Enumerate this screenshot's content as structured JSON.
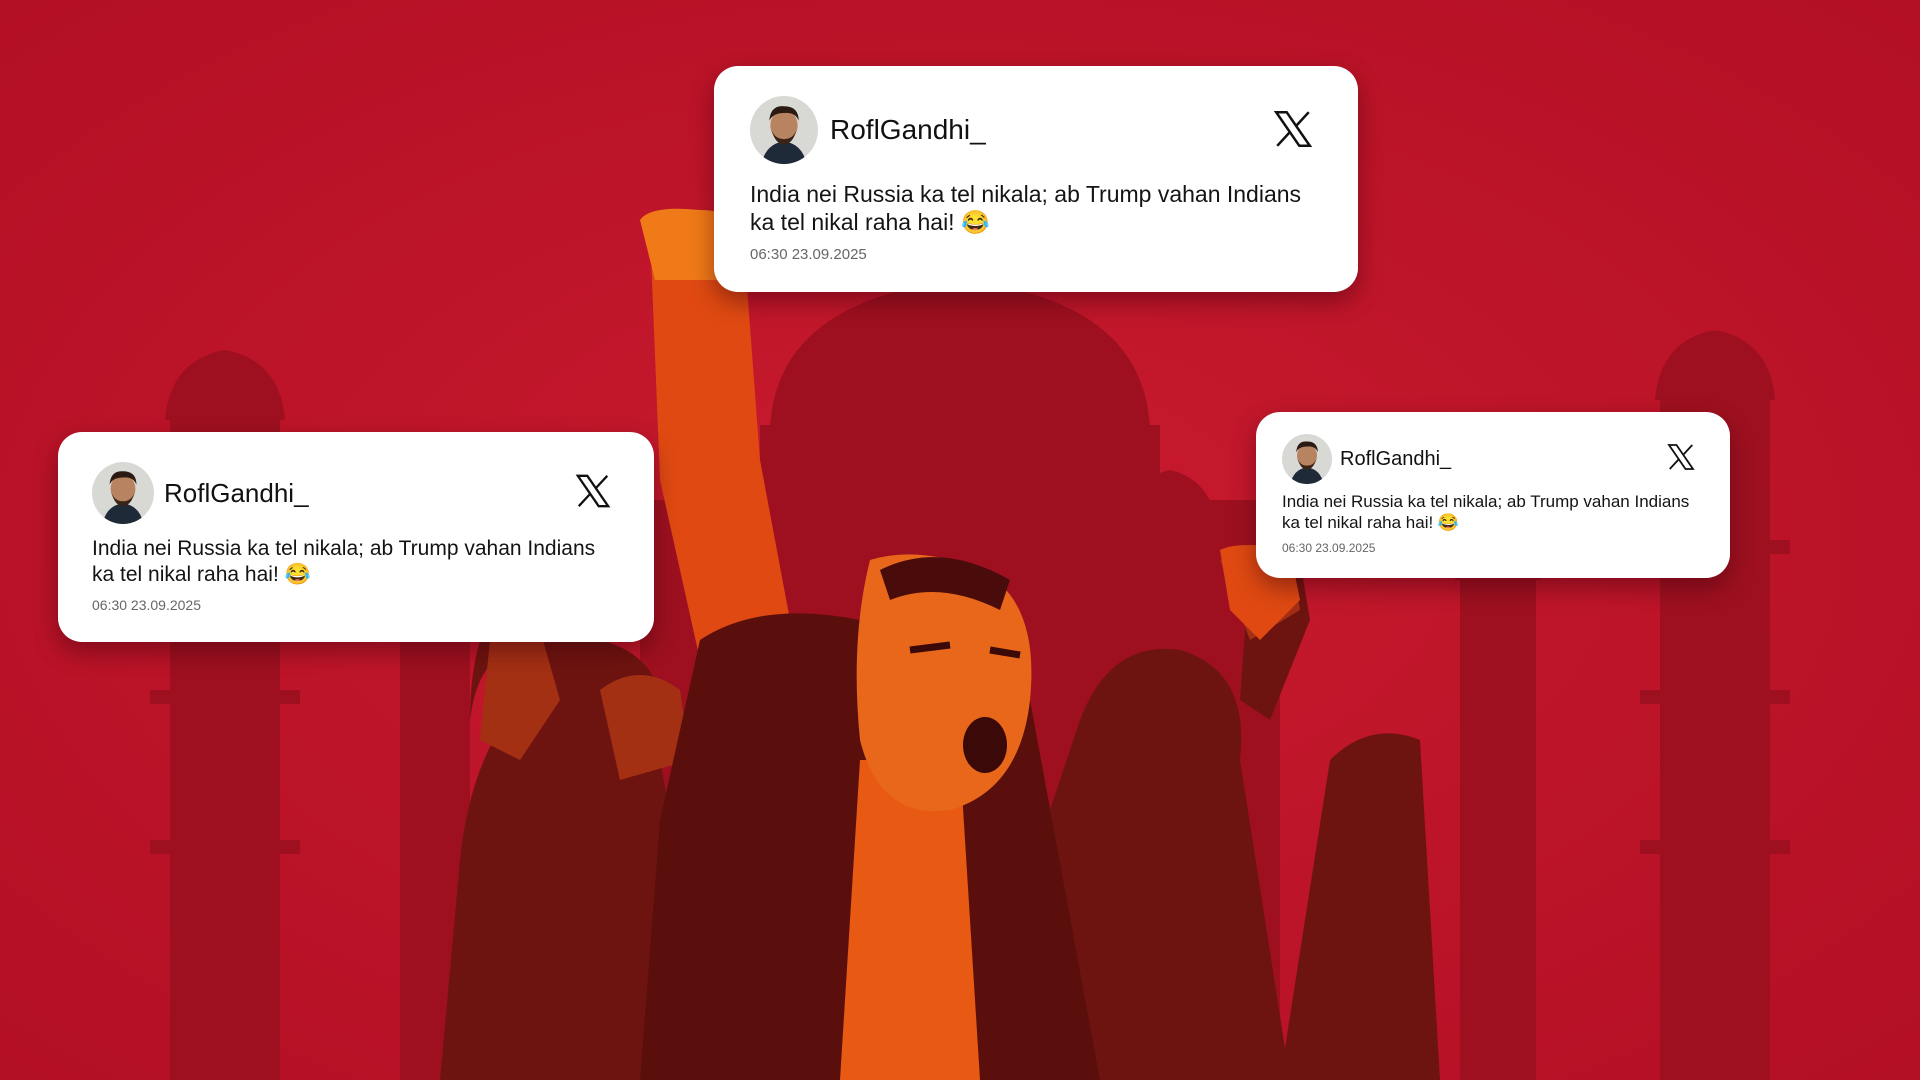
{
  "background": {
    "color": "#c4122a",
    "illustration": "protest-crowd-raised-fists-taj-mahal"
  },
  "tweets": [
    {
      "username": "RoflGandhi_",
      "text": "India nei Russia ka tel nikala; ab Trump vahan Indians ka tel nikal raha hai! 😂",
      "time": "06:30 23.09.2025",
      "platform_icon": "x-logo-icon"
    },
    {
      "username": "RoflGandhi_",
      "text": "India nei Russia ka tel nikala; ab Trump vahan Indians ka tel nikal raha hai! 😂",
      "time": "06:30 23.09.2025",
      "platform_icon": "x-logo-icon"
    },
    {
      "username": "RoflGandhi_",
      "text": "India nei Russia ka tel nikala; ab Trump vahan Indians ka tel nikal raha hai! 😂",
      "time": "06:30 23.09.2025",
      "platform_icon": "x-logo-icon"
    }
  ]
}
